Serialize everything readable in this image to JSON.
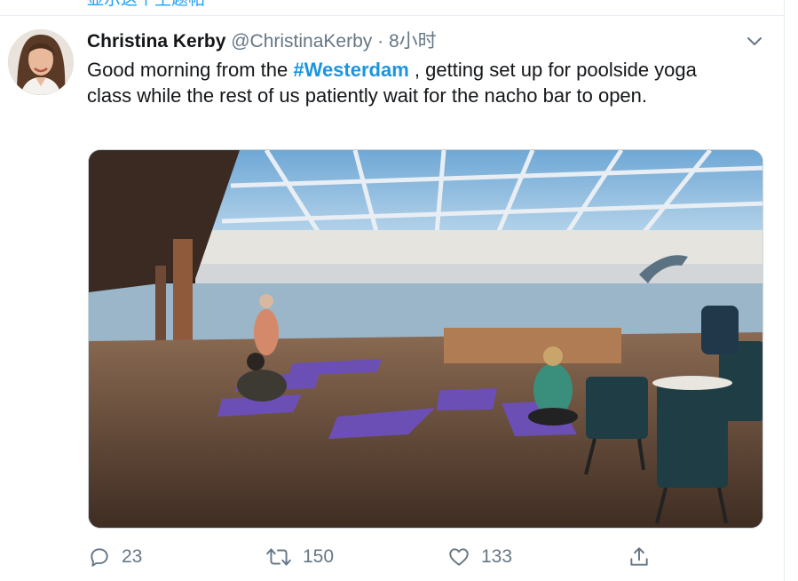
{
  "previous_link": {
    "text": "显示这个主题帖"
  },
  "tweet": {
    "author_name": "Christina Kerby",
    "handle": "@ChristinaKerby",
    "separator": "·",
    "time": "8小时",
    "text_before": "Good morning from the ",
    "hashtag": "#Westerdam",
    "text_after": " , getting set up for poolside yoga class while the rest of us patiently wait for the nacho bar to open."
  },
  "actions": {
    "reply_count": "23",
    "retweet_count": "150",
    "like_count": "133"
  },
  "icons": {
    "more": "chevron-down-icon",
    "reply": "reply-icon",
    "retweet": "retweet-icon",
    "like": "heart-icon",
    "share": "share-icon"
  },
  "colors": {
    "accent": "#1da1f2",
    "hashtag": "#1b95e0",
    "secondary_text": "#657786",
    "divider": "#e6ecf0"
  }
}
